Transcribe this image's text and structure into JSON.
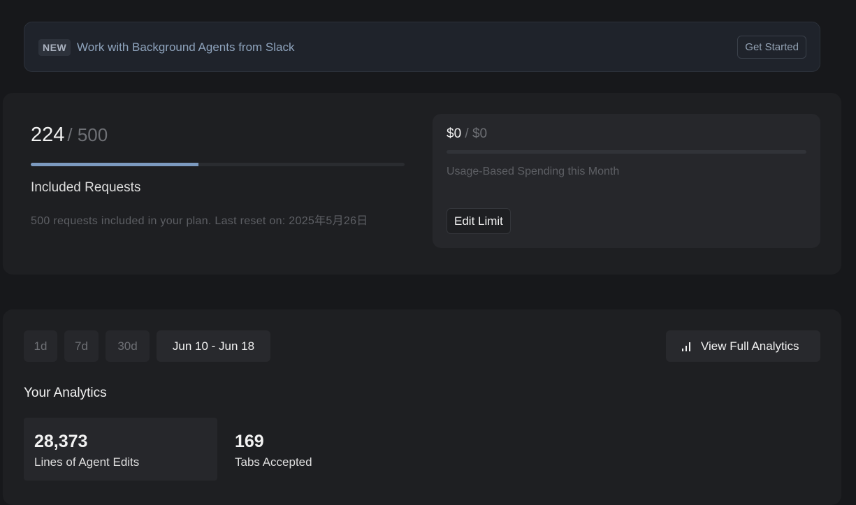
{
  "banner": {
    "badge": "NEW",
    "text": "Work with Background Agents from Slack",
    "button": "Get Started"
  },
  "requests": {
    "used": "224",
    "total": "/ 500",
    "progress_fraction": 0.448,
    "label": "Included Requests",
    "description": "500 requests included in your plan. Last reset on: 2025年5月26日"
  },
  "spending": {
    "amount": "$0",
    "limit": " / $0",
    "label": "Usage-Based Spending this Month",
    "edit_button": "Edit Limit"
  },
  "analytics": {
    "ranges": [
      {
        "label": "1d",
        "active": false
      },
      {
        "label": "7d",
        "active": false
      },
      {
        "label": "30d",
        "active": false
      },
      {
        "label": "Jun 10 - Jun 18",
        "active": true
      }
    ],
    "full_button": "View Full Analytics",
    "full_button_icon": "bar-chart-icon",
    "title": "Your Analytics",
    "stats": [
      {
        "value": "28,373",
        "label": "Lines of Agent Edits"
      },
      {
        "value": "169",
        "label": "Tabs Accepted"
      }
    ]
  }
}
